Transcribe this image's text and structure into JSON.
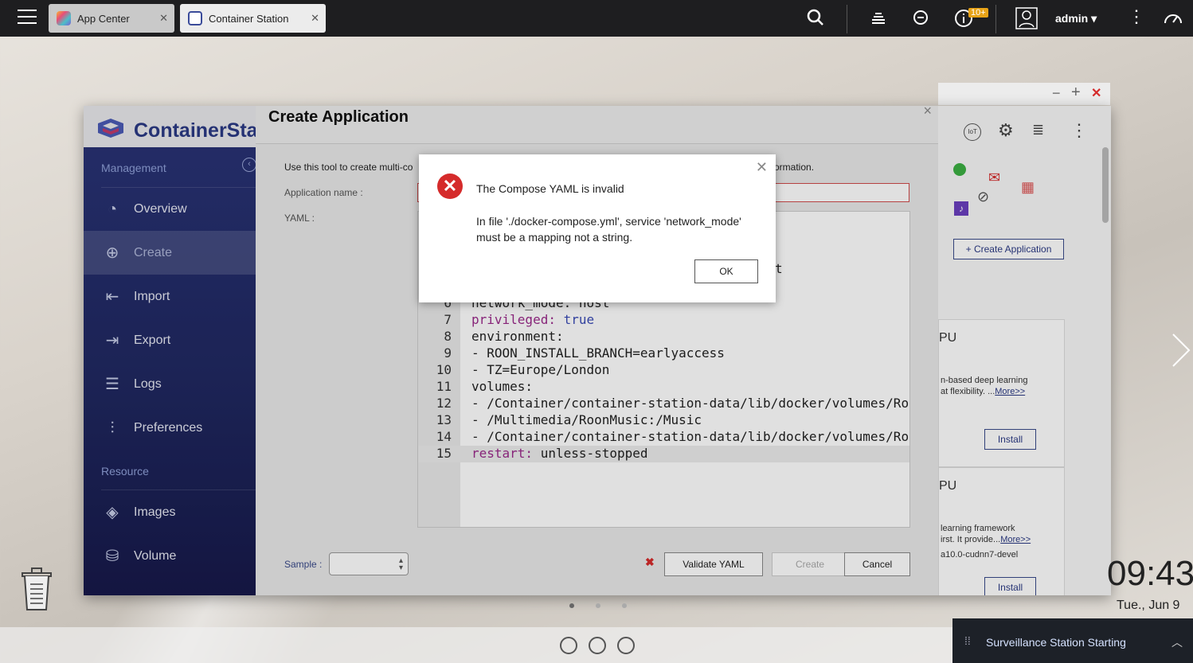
{
  "topbar": {
    "tabs": [
      {
        "label": "App Center"
      },
      {
        "label": "Container Station"
      }
    ],
    "notification_count": "10+",
    "user": "admin"
  },
  "window": {
    "app_title": "ContainerStation",
    "sidebar": {
      "section_management": "Management",
      "section_resource": "Resource",
      "items": [
        {
          "label": "Overview",
          "icon": "overview-icon"
        },
        {
          "label": "Create",
          "icon": "create-icon"
        },
        {
          "label": "Import",
          "icon": "import-icon"
        },
        {
          "label": "Export",
          "icon": "export-icon"
        },
        {
          "label": "Logs",
          "icon": "logs-icon"
        },
        {
          "label": "Preferences",
          "icon": "preferences-icon"
        },
        {
          "label": "Images",
          "icon": "images-icon"
        },
        {
          "label": "Volume",
          "icon": "volume-icon"
        }
      ]
    },
    "right": {
      "create_application": "Create Application",
      "card1_title": "PU",
      "card1_desc1": "n-based deep learning",
      "card1_desc2": "at flexibility. ...",
      "card1_more": "More>>",
      "card2_title": "PU",
      "card2_desc1": "learning framework",
      "card2_desc2": "irst. It provide...",
      "card2_more": "More>>",
      "card2_tag": "a10.0-cudnn7-devel",
      "install": "Install"
    }
  },
  "create_app": {
    "title": "Create Application",
    "intro": "Use this tool to create multi-co",
    "intro_tail": "ormation.",
    "app_name_label": "Application name :",
    "yaml_label": "YAML :",
    "sample_label": "Sample :",
    "validate": "Validate YAML",
    "create": "Create",
    "cancel": "Cancel",
    "code": [
      {
        "n": "6",
        "text": "network_mode: host"
      },
      {
        "n": "7",
        "k": "privileged:",
        "v": "true"
      },
      {
        "n": "8",
        "k": "environment:"
      },
      {
        "n": "9",
        "text": "- ROON_INSTALL_BRANCH=earlyaccess"
      },
      {
        "n": "10",
        "text": "- TZ=Europe/London"
      },
      {
        "n": "11",
        "k": "volumes:"
      },
      {
        "n": "12",
        "text": "- /Container/container-station-data/lib/docker/volumes/Roo"
      },
      {
        "n": "13",
        "text": "- /Multimedia/RoonMusic:/Music"
      },
      {
        "n": "14",
        "text": "- /Container/container-station-data/lib/docker/volumes/Roo"
      },
      {
        "n": "15",
        "k": "restart:",
        "v": "unless-stopped"
      }
    ],
    "hidden_fragment": "t"
  },
  "modal": {
    "title": "The Compose YAML is invalid",
    "message": "In file './docker-compose.yml', service 'network_mode' must be a mapping not a string.",
    "ok": "OK"
  },
  "desktop": {
    "time": "09:43",
    "date": "Tue., Jun 9",
    "notification": "Surveillance Station Starting"
  }
}
